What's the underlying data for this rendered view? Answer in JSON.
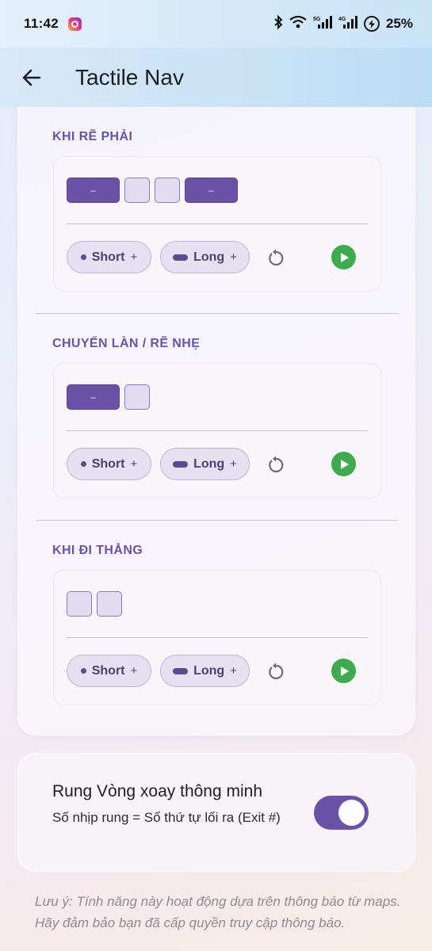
{
  "status_bar": {
    "time": "11:42",
    "battery": "25%",
    "icons": [
      "instagram-icon",
      "bluetooth-icon",
      "wifi-icon",
      "5g-signal-icon",
      "4g-signal-icon",
      "battery-charging-icon"
    ]
  },
  "app_bar": {
    "title": "Tactile Nav",
    "back_icon": "arrow-left-icon"
  },
  "sections": [
    {
      "title": "KHI RẼ PHẢI",
      "pattern": [
        "long",
        "short",
        "short",
        "long"
      ],
      "long_mark": "–",
      "short_chip": "Short",
      "long_chip": "Long",
      "plus": "+"
    },
    {
      "title": "CHUYỂN LÀN / RẼ NHẸ",
      "pattern": [
        "long",
        "short"
      ],
      "long_mark": "–",
      "short_chip": "Short",
      "long_chip": "Long",
      "plus": "+"
    },
    {
      "title": "KHI ĐI THẲNG",
      "pattern": [
        "short",
        "short"
      ],
      "long_mark": "–",
      "short_chip": "Short",
      "long_chip": "Long",
      "plus": "+"
    }
  ],
  "smart_rotation": {
    "title": "Rung Vòng xoay thông minh",
    "subtitle": "Số nhịp rung = Số thứ tự lối ra (Exit #)",
    "enabled": true,
    "accent": "#6a52a8"
  },
  "note": "Lưu ý: Tính năng này hoạt động dựa trên thông báo từ maps. Hãy đảm bảo bạn đã cấp quyền truy cập thông báo.",
  "colors": {
    "accent": "#6a52a8",
    "play": "#3eab4f",
    "chip_bg": "#e6e0f0"
  }
}
